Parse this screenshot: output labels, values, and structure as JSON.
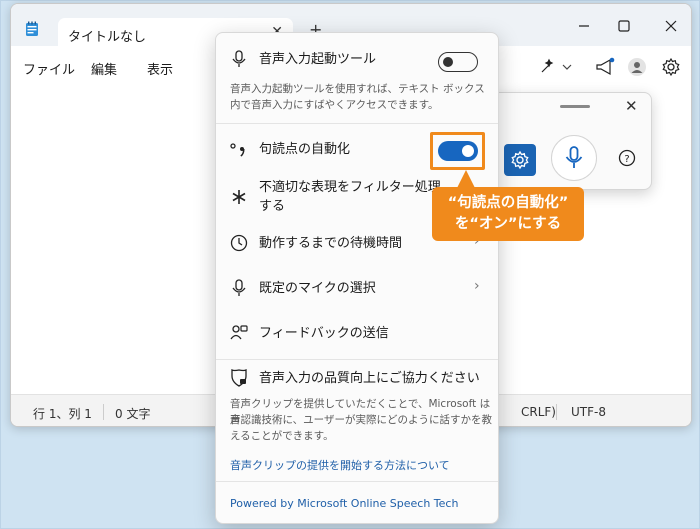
{
  "notepad": {
    "tab_title": "タイトルなし",
    "tab_close": "✕",
    "tab_add": "+",
    "menu": {
      "file": "ファイル",
      "edit": "編集",
      "view": "表示"
    },
    "status": {
      "position": "行 1、列 1",
      "chars": "0 文字",
      "line_ending": "CRLF)",
      "encoding": "UTF-8"
    }
  },
  "voice_bar": {
    "close": "✕",
    "help": "?"
  },
  "flyout": {
    "launcher": {
      "label": "音声入力起動ツール",
      "desc1": "音声入力起動ツールを使用すれば、テキスト ボックス",
      "desc2": "内で音声入力にすばやくアクセスできます。",
      "toggle_on": false
    },
    "punctuation": {
      "label": "句読点の自動化",
      "toggle_on": true
    },
    "filter": {
      "label1": "不適切な表現をフィルター処理",
      "label2": "する"
    },
    "wait_time": {
      "label": "動作するまでの待機時間",
      "chevron": "›"
    },
    "mic": {
      "label": "既定のマイクの選択",
      "chevron": "›"
    },
    "feedback": {
      "label": "フィードバックの送信"
    },
    "quality": {
      "label": "音声入力の品質向上にご協力ください",
      "desc1": "音声クリップを提供していただくことで、Microsoft は音",
      "desc2": "声認識技術に、ユーザーが実際にどのように話すかを教",
      "desc3": "えることができます。",
      "link": "音声クリップの提供を開始する方法について"
    },
    "powered_by": "Powered by Microsoft Online Speech Tech"
  },
  "annotation": {
    "line1": "“句読点の自動化”",
    "line2": "を“オン”にする",
    "color": "#f08a1c"
  },
  "colors": {
    "accent": "#1766c0",
    "settings_button": "#1b64b3",
    "link": "#1f5fa8"
  }
}
